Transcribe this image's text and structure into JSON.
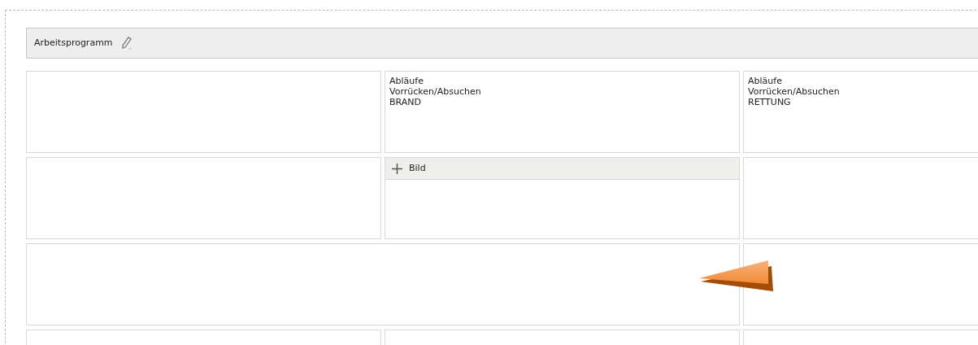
{
  "header": {
    "title": "Arbeitsprogramm"
  },
  "rows": [
    {
      "cells": [
        {
          "kind": "empty"
        },
        {
          "kind": "text",
          "lines": [
            "Abläufe",
            "Vorrücken/Absuchen",
            "BRAND"
          ]
        },
        {
          "kind": "text",
          "lines": [
            "Abläufe",
            "Vorrücken/Absuchen",
            "RETTUNG"
          ]
        }
      ]
    },
    {
      "cells": [
        {
          "kind": "empty"
        },
        {
          "kind": "image_add",
          "label": "Bild"
        },
        {
          "kind": "empty"
        }
      ]
    },
    {
      "cells": [
        {
          "kind": "empty",
          "wide": true
        },
        {
          "kind": "empty"
        }
      ]
    },
    {
      "cells": [
        {
          "kind": "empty"
        },
        {
          "kind": "empty"
        },
        {
          "kind": "empty"
        }
      ]
    }
  ]
}
